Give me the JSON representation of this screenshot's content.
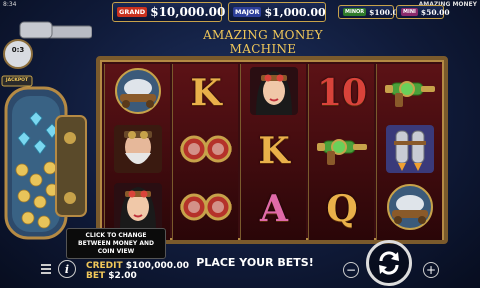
{
  "status_bar": {
    "time": "8:34",
    "game_name": "AMAZING MONEY"
  },
  "jackpots": [
    {
      "tag": "GRAND",
      "value": "$10,000.00",
      "tag_color": "#c8311f"
    },
    {
      "tag": "MAJOR",
      "value": "$1,000.00",
      "tag_color": "#2d3f9a"
    },
    {
      "tag": "MINOR",
      "value": "$100.00",
      "tag_color": "#2e7a2a"
    },
    {
      "tag": "MINI",
      "value": "$50.00",
      "tag_color": "#8a2a6a"
    }
  ],
  "title": "AMAZING MONEY MACHINE",
  "machine": {
    "counter": "0:3",
    "label": "JACKPOT"
  },
  "reels": [
    [
      {
        "type": "pic",
        "icon": "steampunk-vehicle-icon"
      },
      {
        "type": "pic",
        "icon": "inventor-old-man-icon"
      },
      {
        "type": "pic",
        "icon": "steampunk-woman-icon"
      }
    ],
    [
      {
        "type": "letter",
        "text": "K",
        "color": "#e9b04a"
      },
      {
        "type": "pic",
        "icon": "goggles-icon"
      },
      {
        "type": "pic",
        "icon": "goggles-icon"
      }
    ],
    [
      {
        "type": "pic",
        "icon": "steampunk-woman-icon"
      },
      {
        "type": "letter",
        "text": "K",
        "color": "#e9b04a"
      },
      {
        "type": "letter",
        "text": "A",
        "color": "#e06aa8"
      }
    ],
    [
      {
        "type": "letter",
        "text": "10",
        "color": "#d9433a"
      },
      {
        "type": "pic",
        "icon": "raygun-icon"
      },
      {
        "type": "letter",
        "text": "Q",
        "color": "#e9b04a"
      }
    ],
    [
      {
        "type": "pic",
        "icon": "raygun-icon"
      },
      {
        "type": "pic",
        "icon": "jetpack-icon"
      },
      {
        "type": "pic",
        "icon": "steampunk-vehicle-icon"
      }
    ]
  ],
  "tooltip": "CLICK TO CHANGE BETWEEN MONEY AND COIN VIEW",
  "credit_label": "CREDIT",
  "credit_value": "$100,000.00",
  "bet_label": "BET",
  "bet_value": "$2.00",
  "message": "PLACE YOUR BETS!",
  "colors": {
    "gold": "#f1c85a",
    "frame": "#7a5a2c",
    "reel_bg": "#4a0e12"
  }
}
